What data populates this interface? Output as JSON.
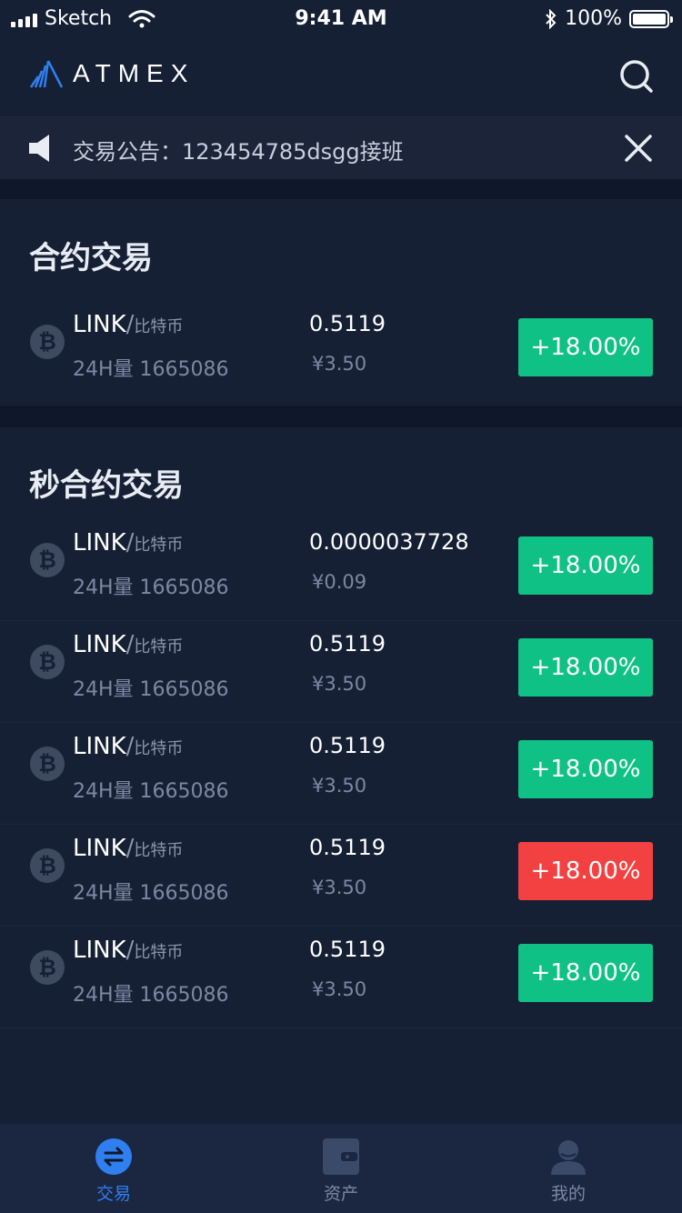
{
  "status_bar": {
    "carrier": "Sketch",
    "time": "9:41 AM",
    "battery": "100%"
  },
  "header": {
    "logo_text": "ATMEX"
  },
  "announcement": {
    "text": "交易公告：123454785dsgg接班"
  },
  "contract_section": {
    "title": "合约交易",
    "rows": [
      {
        "base": "LINK",
        "slash": "/",
        "quote": "比特币",
        "volume": "24H量 1665086",
        "price": "0.5119",
        "cny": "¥3.50",
        "change": "+18.00%",
        "change_color": "#10c186"
      }
    ]
  },
  "second_contract_section": {
    "title": "秒合约交易",
    "rows": [
      {
        "base": "LINK",
        "slash": "/",
        "quote": "比特币",
        "volume": "24H量 1665086",
        "price": "0.0000037728",
        "cny": "¥0.09",
        "change": "+18.00%",
        "change_color": "#10c186"
      },
      {
        "base": "LINK",
        "slash": "/",
        "quote": "比特币",
        "volume": "24H量 1665086",
        "price": "0.5119",
        "cny": "¥3.50",
        "change": "+18.00%",
        "change_color": "#10c186"
      },
      {
        "base": "LINK",
        "slash": "/",
        "quote": "比特币",
        "volume": "24H量 1665086",
        "price": "0.5119",
        "cny": "¥3.50",
        "change": "+18.00%",
        "change_color": "#10c186"
      },
      {
        "base": "LINK",
        "slash": "/",
        "quote": "比特币",
        "volume": "24H量 1665086",
        "price": "0.5119",
        "cny": "¥3.50",
        "change": "+18.00%",
        "change_color": "#f34141"
      },
      {
        "base": "LINK",
        "slash": "/",
        "quote": "比特币",
        "volume": "24H量 1665086",
        "price": "0.5119",
        "cny": "¥3.50",
        "change": "+18.00%",
        "change_color": "#10c186"
      }
    ]
  },
  "tabbar": {
    "items": [
      {
        "label": "交易",
        "icon": "exchange-icon",
        "active": true
      },
      {
        "label": "资产",
        "icon": "wallet-icon",
        "active": false
      },
      {
        "label": "我的",
        "icon": "user-icon",
        "active": false
      }
    ]
  },
  "colors": {
    "background": "#162035",
    "up": "#10c186",
    "down": "#f34141",
    "accent": "#2f7ff0"
  }
}
